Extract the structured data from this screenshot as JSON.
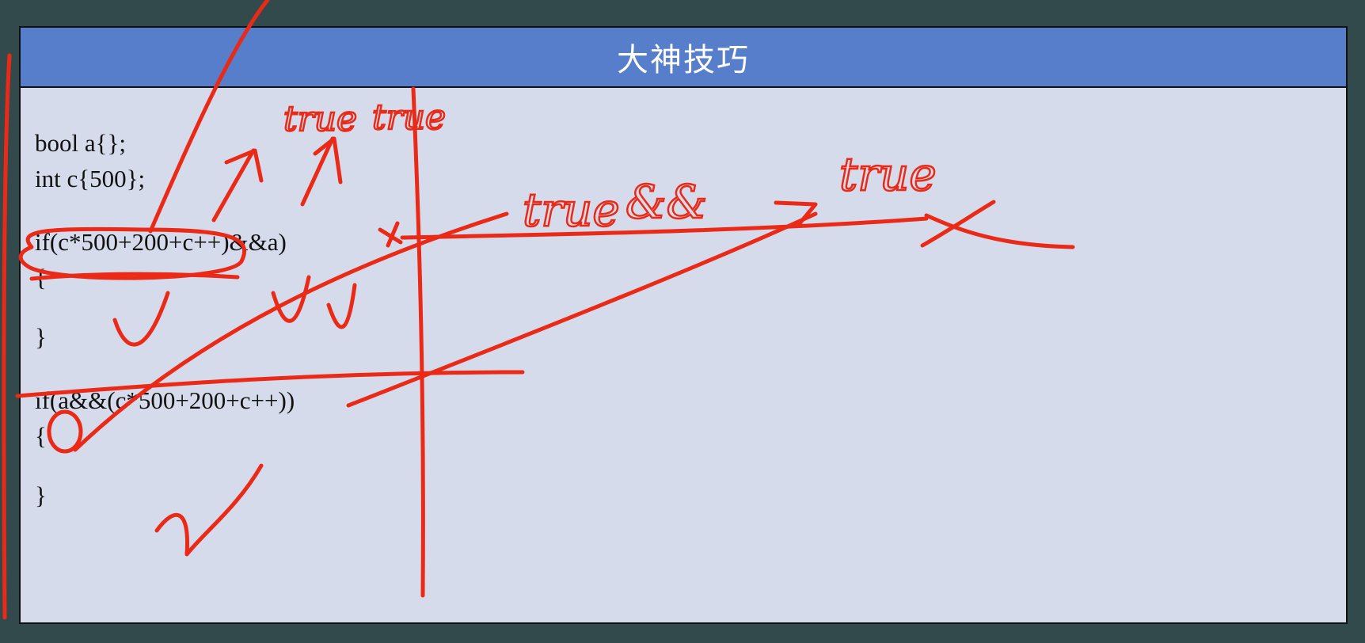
{
  "slide": {
    "title": "大神技巧"
  },
  "code_lines": [
    "bool a{};",
    "int c{500};",
    "if(c*500+200+c++)&&a)",
    "{",
    "}",
    "if(a&&(c*500+200+c++))",
    "{",
    "}"
  ],
  "annotations": {
    "word_true_1": "true",
    "word_and": "&&",
    "word_true_2": "true",
    "word_true_top_1": "true",
    "word_true_top_2": "true"
  },
  "colors": {
    "background": "#334a4d",
    "header": "#567ecb",
    "slide_body": "#d6dbeb",
    "ink": "#ea2a17"
  }
}
